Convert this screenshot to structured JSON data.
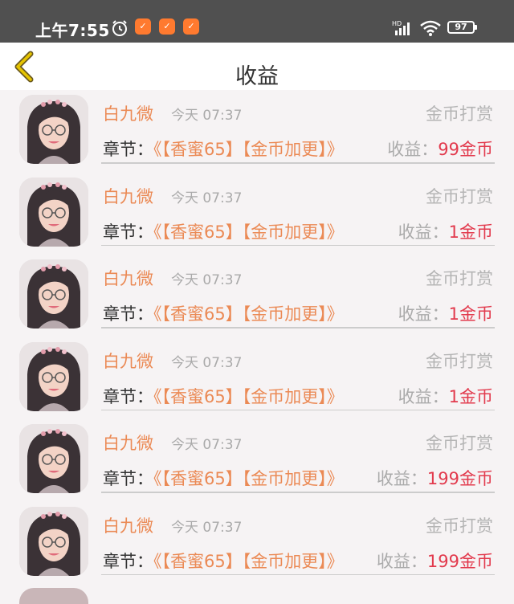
{
  "status_bar": {
    "time": "上午7:55",
    "app_badge_glyph": "✓",
    "battery": "97",
    "network_label": "HD"
  },
  "nav": {
    "title": "收益"
  },
  "records": [
    {
      "name": "白九微",
      "time": "今天 07:37",
      "type": "金币打赏",
      "chapter_label": "章节：",
      "chapter": "《【香蜜65】【金币加更】》",
      "earnings_label": "收益：",
      "earnings_amount": "99金币"
    },
    {
      "name": "白九微",
      "time": "今天 07:37",
      "type": "金币打赏",
      "chapter_label": "章节：",
      "chapter": "《【香蜜65】【金币加更】》",
      "earnings_label": "收益：",
      "earnings_amount": "1金币"
    },
    {
      "name": "白九微",
      "time": "今天 07:37",
      "type": "金币打赏",
      "chapter_label": "章节：",
      "chapter": "《【香蜜65】【金币加更】》",
      "earnings_label": "收益：",
      "earnings_amount": "1金币"
    },
    {
      "name": "白九微",
      "time": "今天 07:37",
      "type": "金币打赏",
      "chapter_label": "章节：",
      "chapter": "《【香蜜65】【金币加更】》",
      "earnings_label": "收益：",
      "earnings_amount": "1金币"
    },
    {
      "name": "白九微",
      "time": "今天 07:37",
      "type": "金币打赏",
      "chapter_label": "章节：",
      "chapter": "《【香蜜65】【金币加更】》",
      "earnings_label": "收益：",
      "earnings_amount": "199金币"
    },
    {
      "name": "白九微",
      "time": "今天 07:37",
      "type": "金币打赏",
      "chapter_label": "章节：",
      "chapter": "《【香蜜65】【金币加更】》",
      "earnings_label": "收益：",
      "earnings_amount": "199金币"
    }
  ],
  "colors": {
    "accent": "#eb8a55",
    "earnings": "#e23a4d",
    "back_arrow": "#e6c400"
  }
}
